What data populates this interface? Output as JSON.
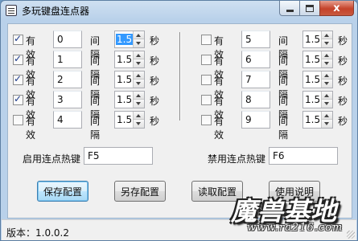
{
  "window": {
    "title": "多玩键盘连点器",
    "close_glyph": "x"
  },
  "labels": {
    "valid": "有效",
    "interval": "间隔",
    "seconds": "秒"
  },
  "left_rows": [
    {
      "checked": true,
      "key": "0",
      "interval": "1.5"
    },
    {
      "checked": true,
      "key": "1",
      "interval": "1.5"
    },
    {
      "checked": true,
      "key": "2",
      "interval": "1.5"
    },
    {
      "checked": true,
      "key": "3",
      "interval": "1.5"
    },
    {
      "checked": false,
      "key": "4",
      "interval": "1.5"
    }
  ],
  "right_rows": [
    {
      "checked": false,
      "key": "5",
      "interval": "1.5"
    },
    {
      "checked": false,
      "key": "6",
      "interval": "1.5"
    },
    {
      "checked": false,
      "key": "7",
      "interval": "1.5"
    },
    {
      "checked": false,
      "key": "8",
      "interval": "1.5"
    },
    {
      "checked": false,
      "key": "9",
      "interval": "1.5"
    }
  ],
  "hotkeys": {
    "enable_label": "启用连点热键",
    "enable_value": "F5",
    "disable_label": "禁用连点热键",
    "disable_value": "F6"
  },
  "buttons": {
    "save": "保存配置",
    "save_as": "另存配置",
    "load": "读取配置",
    "help": "使用说明"
  },
  "status": {
    "version": "版本：1.0.0.2"
  },
  "watermark": {
    "main": "魔兽基地",
    "url": "www.ra216.com"
  }
}
